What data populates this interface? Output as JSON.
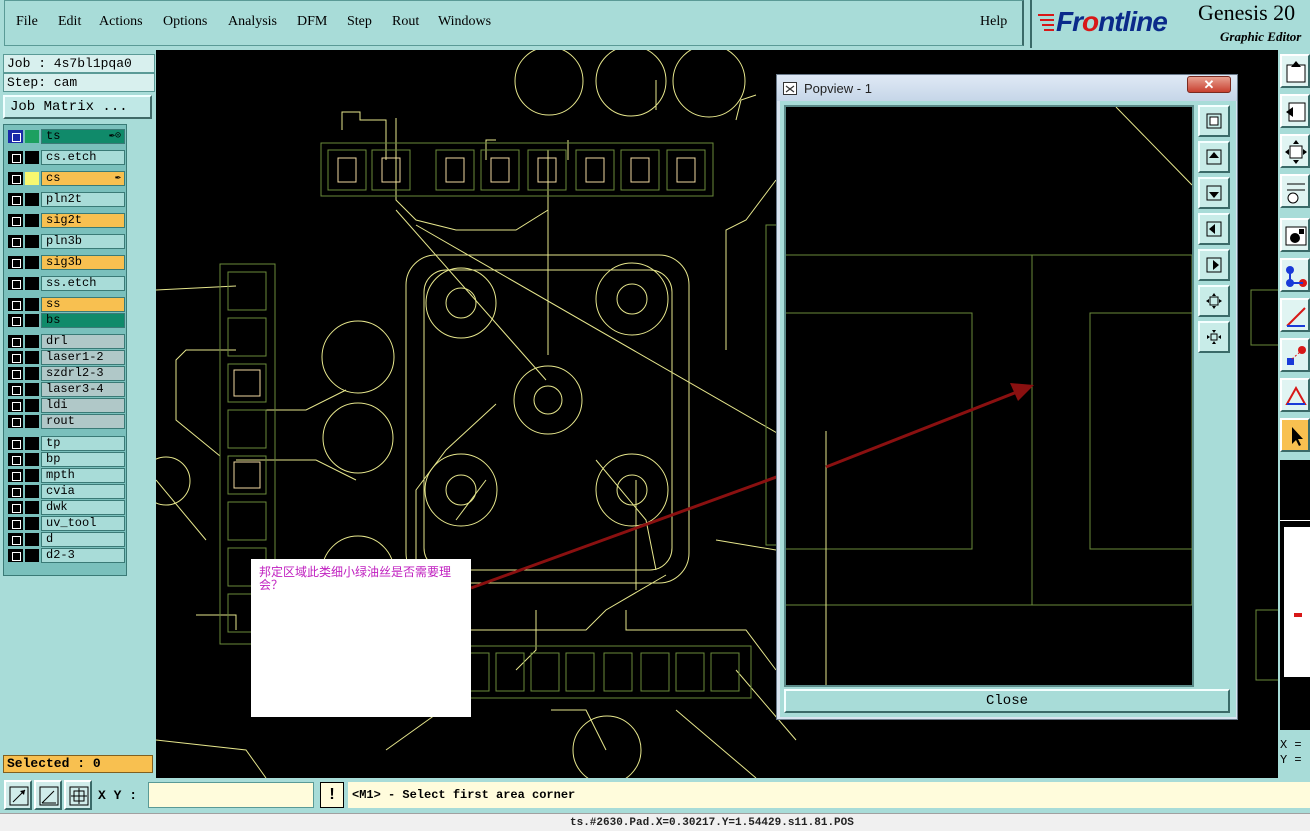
{
  "menubar": {
    "items": [
      "File",
      "Edit",
      "Actions",
      "Options",
      "Analysis",
      "DFM",
      "Step",
      "Rout",
      "Windows"
    ],
    "help": "Help"
  },
  "logo": {
    "brand_prefix": "Fr",
    "brand_o": "o",
    "brand_suffix": "ntline",
    "product": "Genesis 20",
    "subtitle": "Graphic Editor"
  },
  "info": {
    "job": "Job : 4s7bl1pqa0",
    "step": "Step: cam",
    "job_matrix": "Job Matrix ..."
  },
  "layers": [
    {
      "name": "ts",
      "style": "green",
      "swatch": "#1ca060",
      "mark": "✒⊙"
    },
    {
      "name": "cs.etch",
      "style": "plain",
      "swatch": "#000000",
      "mark": ""
    },
    {
      "name": "cs",
      "style": "orange",
      "swatch": "#f8f870",
      "mark": "✒"
    },
    {
      "name": "pln2t",
      "style": "plain",
      "swatch": "#000000",
      "mark": ""
    },
    {
      "name": "sig2t",
      "style": "orange",
      "swatch": "#000000",
      "mark": ""
    },
    {
      "name": "pln3b",
      "style": "plain",
      "swatch": "#000000",
      "mark": ""
    },
    {
      "name": "sig3b",
      "style": "orange",
      "swatch": "#000000",
      "mark": ""
    },
    {
      "name": "ss.etch",
      "style": "plain",
      "swatch": "#000000",
      "mark": ""
    },
    {
      "name": "ss",
      "style": "orange",
      "swatch": "#000000",
      "mark": ""
    },
    {
      "name": "bs",
      "style": "green",
      "swatch": "#000000",
      "mark": ""
    },
    {
      "name": "drl",
      "style": "drill",
      "swatch": "#000000",
      "mark": ""
    },
    {
      "name": "laser1-2",
      "style": "drill",
      "swatch": "#000000",
      "mark": ""
    },
    {
      "name": "szdrl2-3",
      "style": "drill",
      "swatch": "#000000",
      "mark": ""
    },
    {
      "name": "laser3-4",
      "style": "drill",
      "swatch": "#000000",
      "mark": ""
    },
    {
      "name": "ldi",
      "style": "drill",
      "swatch": "#000000",
      "mark": ""
    },
    {
      "name": "rout",
      "style": "drill",
      "swatch": "#000000",
      "mark": ""
    },
    {
      "name": "tp",
      "style": "plain",
      "swatch": "#000000",
      "mark": ""
    },
    {
      "name": "bp",
      "style": "plain",
      "swatch": "#000000",
      "mark": ""
    },
    {
      "name": "mpth",
      "style": "plain",
      "swatch": "#000000",
      "mark": ""
    },
    {
      "name": "cvia",
      "style": "plain",
      "swatch": "#000000",
      "mark": ""
    },
    {
      "name": "dwk",
      "style": "plain",
      "swatch": "#000000",
      "mark": ""
    },
    {
      "name": "uv_tool",
      "style": "plain",
      "swatch": "#000000",
      "mark": ""
    },
    {
      "name": "d",
      "style": "plain",
      "swatch": "#000000",
      "mark": ""
    },
    {
      "name": "d2-3",
      "style": "plain",
      "swatch": "#000000",
      "mark": ""
    }
  ],
  "selected": "Selected : 0",
  "note": {
    "text": "邦定区域此类细小绿油丝是否需要理会？"
  },
  "popview": {
    "title": "Popview - 1",
    "close_x": "✕",
    "close_button": "Close"
  },
  "readout": {
    "x": "X =",
    "y": "Y ="
  },
  "bottom": {
    "xy_label": "X Y :",
    "xy_value": "",
    "excl": "!",
    "prompt": "<M1> - Select first area corner"
  },
  "status": "ts.#2630.Pad.X=0.30217.Y=1.54429.s11.81.POS",
  "colors": {
    "board_line": "#e6e68c",
    "copper_pad": "#6a8a3a",
    "arrow": "#8a1010",
    "note_text": "#c020c0"
  }
}
